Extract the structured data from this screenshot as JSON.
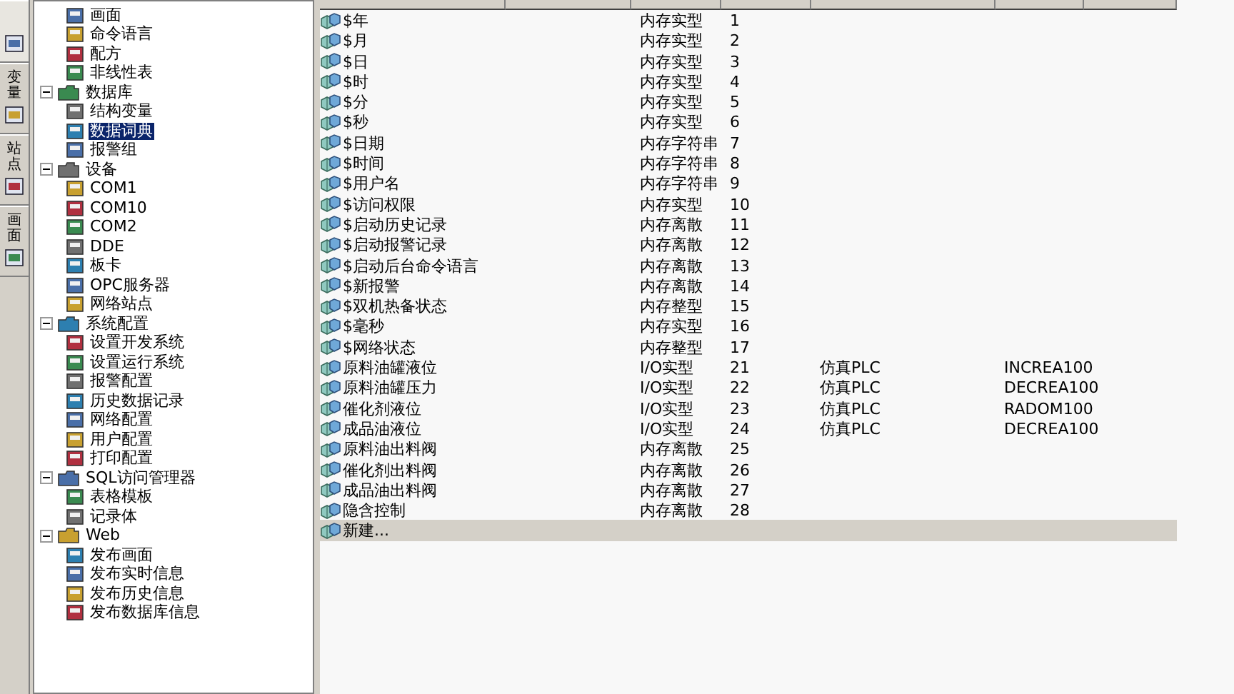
{
  "side_tabs": [
    {
      "selected": true
    },
    {
      "label": "变量",
      "selected": false
    },
    {
      "label": "站点",
      "selected": false
    },
    {
      "label": "画面",
      "selected": false
    }
  ],
  "tree": [
    {
      "children": [
        {
          "label": "画面",
          "selected": false
        },
        {
          "label": "命令语言",
          "selected": false
        },
        {
          "label": "配方",
          "selected": false
        },
        {
          "label": "非线性表",
          "selected": false
        }
      ]
    },
    {
      "label": "数据库",
      "expanded": true,
      "children": [
        {
          "label": "结构变量",
          "selected": false
        },
        {
          "label": "数据词典",
          "selected": true
        },
        {
          "label": "报警组",
          "selected": false
        }
      ]
    },
    {
      "label": "设备",
      "expanded": true,
      "children": [
        {
          "label": "COM1",
          "selected": false
        },
        {
          "label": "COM10",
          "selected": false
        },
        {
          "label": "COM2",
          "selected": false
        },
        {
          "label": "DDE",
          "selected": false
        },
        {
          "label": "板卡",
          "selected": false
        },
        {
          "label": "OPC服务器",
          "selected": false
        },
        {
          "label": "网络站点",
          "selected": false
        }
      ]
    },
    {
      "label": "系统配置",
      "expanded": true,
      "children": [
        {
          "label": "设置开发系统",
          "selected": false
        },
        {
          "label": "设置运行系统",
          "selected": false
        },
        {
          "label": "报警配置",
          "selected": false
        },
        {
          "label": "历史数据记录",
          "selected": false
        },
        {
          "label": "网络配置",
          "selected": false
        },
        {
          "label": "用户配置",
          "selected": false
        },
        {
          "label": "打印配置",
          "selected": false
        }
      ]
    },
    {
      "label": "SQL访问管理器",
      "expanded": true,
      "children": [
        {
          "label": "表格模板",
          "selected": false
        },
        {
          "label": "记录体",
          "selected": false
        }
      ]
    },
    {
      "label": "Web",
      "expanded": true,
      "children": [
        {
          "label": "发布画面",
          "selected": false
        },
        {
          "label": "发布实时信息",
          "selected": false
        },
        {
          "label": "发布历史信息",
          "selected": false
        },
        {
          "label": "发布数据库信息",
          "selected": false
        }
      ]
    }
  ],
  "table": {
    "rows": [
      {
        "name": "$年",
        "type": "内存实型",
        "id": "1",
        "selected": false
      },
      {
        "name": "$月",
        "type": "内存实型",
        "id": "2",
        "selected": false
      },
      {
        "name": "$日",
        "type": "内存实型",
        "id": "3",
        "selected": false
      },
      {
        "name": "$时",
        "type": "内存实型",
        "id": "4",
        "selected": false
      },
      {
        "name": "$分",
        "type": "内存实型",
        "id": "5",
        "selected": false
      },
      {
        "name": "$秒",
        "type": "内存实型",
        "id": "6",
        "selected": false
      },
      {
        "name": "$日期",
        "type": "内存字符串",
        "id": "7",
        "selected": false
      },
      {
        "name": "$时间",
        "type": "内存字符串",
        "id": "8",
        "selected": false
      },
      {
        "name": "$用户名",
        "type": "内存字符串",
        "id": "9",
        "selected": false
      },
      {
        "name": "$访问权限",
        "type": "内存实型",
        "id": "10",
        "selected": false
      },
      {
        "name": "$启动历史记录",
        "type": "内存离散",
        "id": "11",
        "selected": false
      },
      {
        "name": "$启动报警记录",
        "type": "内存离散",
        "id": "12",
        "selected": false
      },
      {
        "name": "$启动后台命令语言",
        "type": "内存离散",
        "id": "13",
        "selected": false
      },
      {
        "name": "$新报警",
        "type": "内存离散",
        "id": "14",
        "selected": false
      },
      {
        "name": "$双机热备状态",
        "type": "内存整型",
        "id": "15",
        "selected": false
      },
      {
        "name": "$毫秒",
        "type": "内存实型",
        "id": "16",
        "selected": false
      },
      {
        "name": "$网络状态",
        "type": "内存整型",
        "id": "17",
        "selected": false
      },
      {
        "name": "原料油罐液位",
        "type": "I/O实型",
        "id": "21",
        "device": "仿真PLC",
        "register": "INCREA100",
        "selected": false
      },
      {
        "name": "原料油罐压力",
        "type": "I/O实型",
        "id": "22",
        "device": "仿真PLC",
        "register": "DECREA100",
        "selected": false
      },
      {
        "name": "催化剂液位",
        "type": "I/O实型",
        "id": "23",
        "device": "仿真PLC",
        "register": "RADOM100",
        "selected": false
      },
      {
        "name": "成品油液位",
        "type": "I/O实型",
        "id": "24",
        "device": "仿真PLC",
        "register": "DECREA100",
        "selected": false
      },
      {
        "name": "原料油出料阀",
        "type": "内存离散",
        "id": "25",
        "selected": false
      },
      {
        "name": "催化剂出料阀",
        "type": "内存离散",
        "id": "26",
        "selected": false
      },
      {
        "name": "成品油出料阀",
        "type": "内存离散",
        "id": "27",
        "selected": false
      },
      {
        "name": "隐含控制",
        "type": "内存离散",
        "id": "28",
        "selected": false
      },
      {
        "name": "新建...",
        "selected": true
      }
    ]
  }
}
